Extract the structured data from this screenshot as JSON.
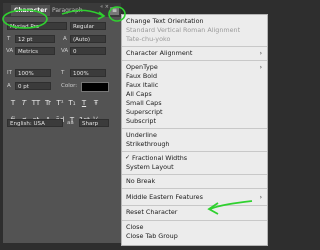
{
  "panel": {
    "tabs": [
      {
        "label": "Character"
      },
      {
        "label": "Paragraph"
      }
    ],
    "menu_glyph": "≡",
    "font_family": "Myriad Pro",
    "font_style": "Regular",
    "font_size": "12 pt",
    "leading": "(Auto)",
    "kerning": "Metrics",
    "tracking": "0",
    "vertical_scale": "100%",
    "horizontal_scale": "100%",
    "baseline_shift": "0 pt",
    "color_label": "Color:",
    "type_styles": [
      "T",
      "T",
      "TT",
      "Tr",
      "T¹",
      "T₁",
      "T",
      "Ŧ"
    ],
    "opentype_styles": [
      "fi",
      "ơ",
      "st",
      "A",
      "ād",
      "T",
      "1st",
      "½"
    ],
    "language": "English: USA",
    "antialias_label": "aa",
    "antialias": "Sharp",
    "panel_close": "« ×"
  },
  "menu": {
    "items": [
      {
        "label": "Change Text Orientation",
        "disabled": false
      },
      {
        "label": "Standard Vertical Roman Alignment",
        "disabled": true
      },
      {
        "label": "Tate-chu-yoko",
        "disabled": true
      },
      {
        "label": "Character Alignment",
        "disabled": false,
        "submenu": true
      },
      {
        "label": "OpenType",
        "disabled": false,
        "submenu": true
      },
      {
        "label": "Faux Bold",
        "disabled": false
      },
      {
        "label": "Faux Italic",
        "disabled": false
      },
      {
        "label": "All Caps",
        "disabled": false
      },
      {
        "label": "Small Caps",
        "disabled": false
      },
      {
        "label": "Superscript",
        "disabled": false
      },
      {
        "label": "Subscript",
        "disabled": false
      },
      {
        "label": "Underline",
        "disabled": false
      },
      {
        "label": "Strikethrough",
        "disabled": false
      },
      {
        "label": "Fractional Widths",
        "disabled": false,
        "checked": true
      },
      {
        "label": "System Layout",
        "disabled": false
      },
      {
        "label": "No Break",
        "disabled": false
      },
      {
        "label": "Middle Eastern Features",
        "disabled": false,
        "submenu": true
      },
      {
        "label": "Reset Character",
        "disabled": false
      },
      {
        "label": "Close",
        "disabled": false
      },
      {
        "label": "Close Tab Group",
        "disabled": false
      }
    ],
    "submenu_arrow": "›",
    "check_mark": "✓"
  },
  "colors": {
    "panel": "#535353",
    "menu": "#ececec",
    "annotation": "#2fd12f"
  }
}
